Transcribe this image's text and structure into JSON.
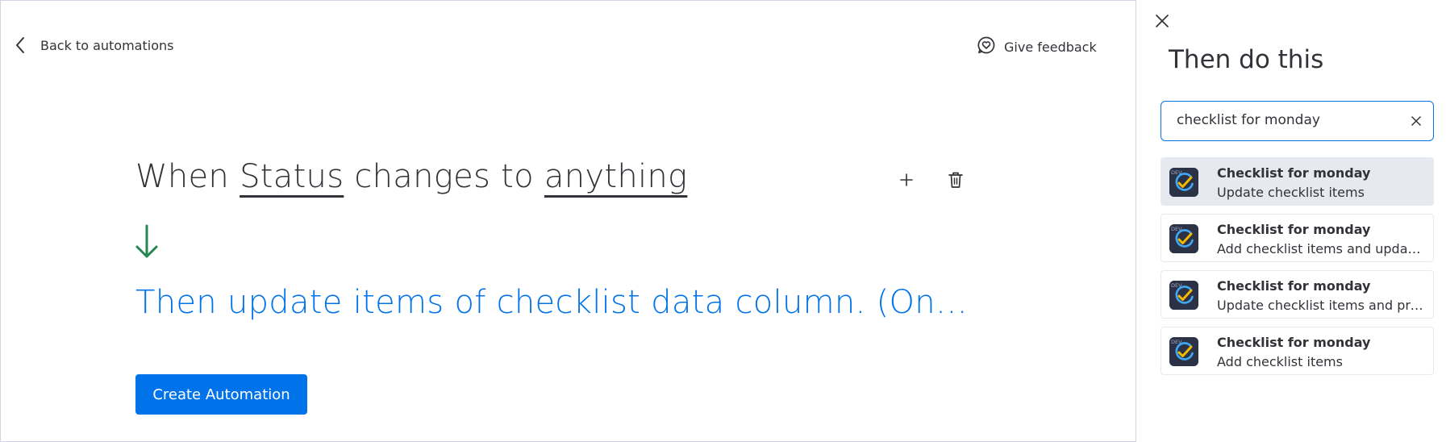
{
  "header": {
    "back_label": "Back to automations",
    "feedback_label": "Give feedback"
  },
  "sentence": {
    "part1": "When ",
    "field1": "Status",
    "part2": " changes to ",
    "field2": "anything"
  },
  "then_line": "Then update items of checklist data column. (Only available on Pro and Enterprise plans)",
  "create_button_label": "Create Automation",
  "panel": {
    "title": "Then do this",
    "search": {
      "value": "checklist for monday",
      "placeholder": ""
    },
    "results": [
      {
        "title": "Checklist for monday",
        "subtitle": "Update checklist items",
        "selected": true,
        "icon": "checklist-app-icon",
        "icon_badge": "DEV"
      },
      {
        "title": "Checklist for monday",
        "subtitle": "Add checklist items and update status",
        "selected": false,
        "icon": "checklist-app-icon",
        "icon_badge": "DEV"
      },
      {
        "title": "Checklist for monday",
        "subtitle": "Update checklist items and progress",
        "selected": false,
        "icon": "checklist-app-icon",
        "icon_badge": "DEV"
      },
      {
        "title": "Checklist for monday",
        "subtitle": "Add checklist items",
        "selected": false,
        "icon": "checklist-app-icon",
        "icon_badge": "DEV"
      }
    ]
  },
  "colors": {
    "primary": "#0073ea",
    "text": "#323338",
    "arrow_green": "#258750",
    "selected_bg": "#e7e9f0",
    "icon_bg": "#2b3245",
    "check_yellow": "#f5b800",
    "check_blue": "#3fa9f5"
  }
}
